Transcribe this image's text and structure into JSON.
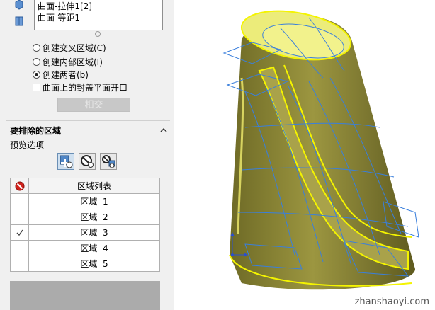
{
  "feature_list": {
    "items": [
      "曲面-拉伸1[2]",
      "曲面-等距1"
    ]
  },
  "options": {
    "radio_intersect": "创建交叉区域(C)",
    "radio_internal": "创建内部区域(I)",
    "radio_both": "创建两者(b)",
    "selected": "创建两者(b)",
    "checkbox_caps": "曲面上的封盖平面开口",
    "checkbox_caps_checked": false
  },
  "intersect_button": "相交",
  "exclude_section": {
    "title": "要排除的区域",
    "preview_label": "预览选项"
  },
  "region_table": {
    "header": "区域列表",
    "rows": [
      {
        "label": "区域",
        "num": "1",
        "checked": false
      },
      {
        "label": "区域",
        "num": "2",
        "checked": false
      },
      {
        "label": "区域",
        "num": "3",
        "checked": true
      },
      {
        "label": "区域",
        "num": "4",
        "checked": false
      },
      {
        "label": "区域",
        "num": "5",
        "checked": false
      }
    ]
  },
  "watermark": "zhanshaoyi.com",
  "colors": {
    "model_fill": "#8f8a3a",
    "model_highlight": "#f2f07a",
    "edge_yellow": "#f4f400",
    "wire_blue": "#3a7fdc"
  }
}
